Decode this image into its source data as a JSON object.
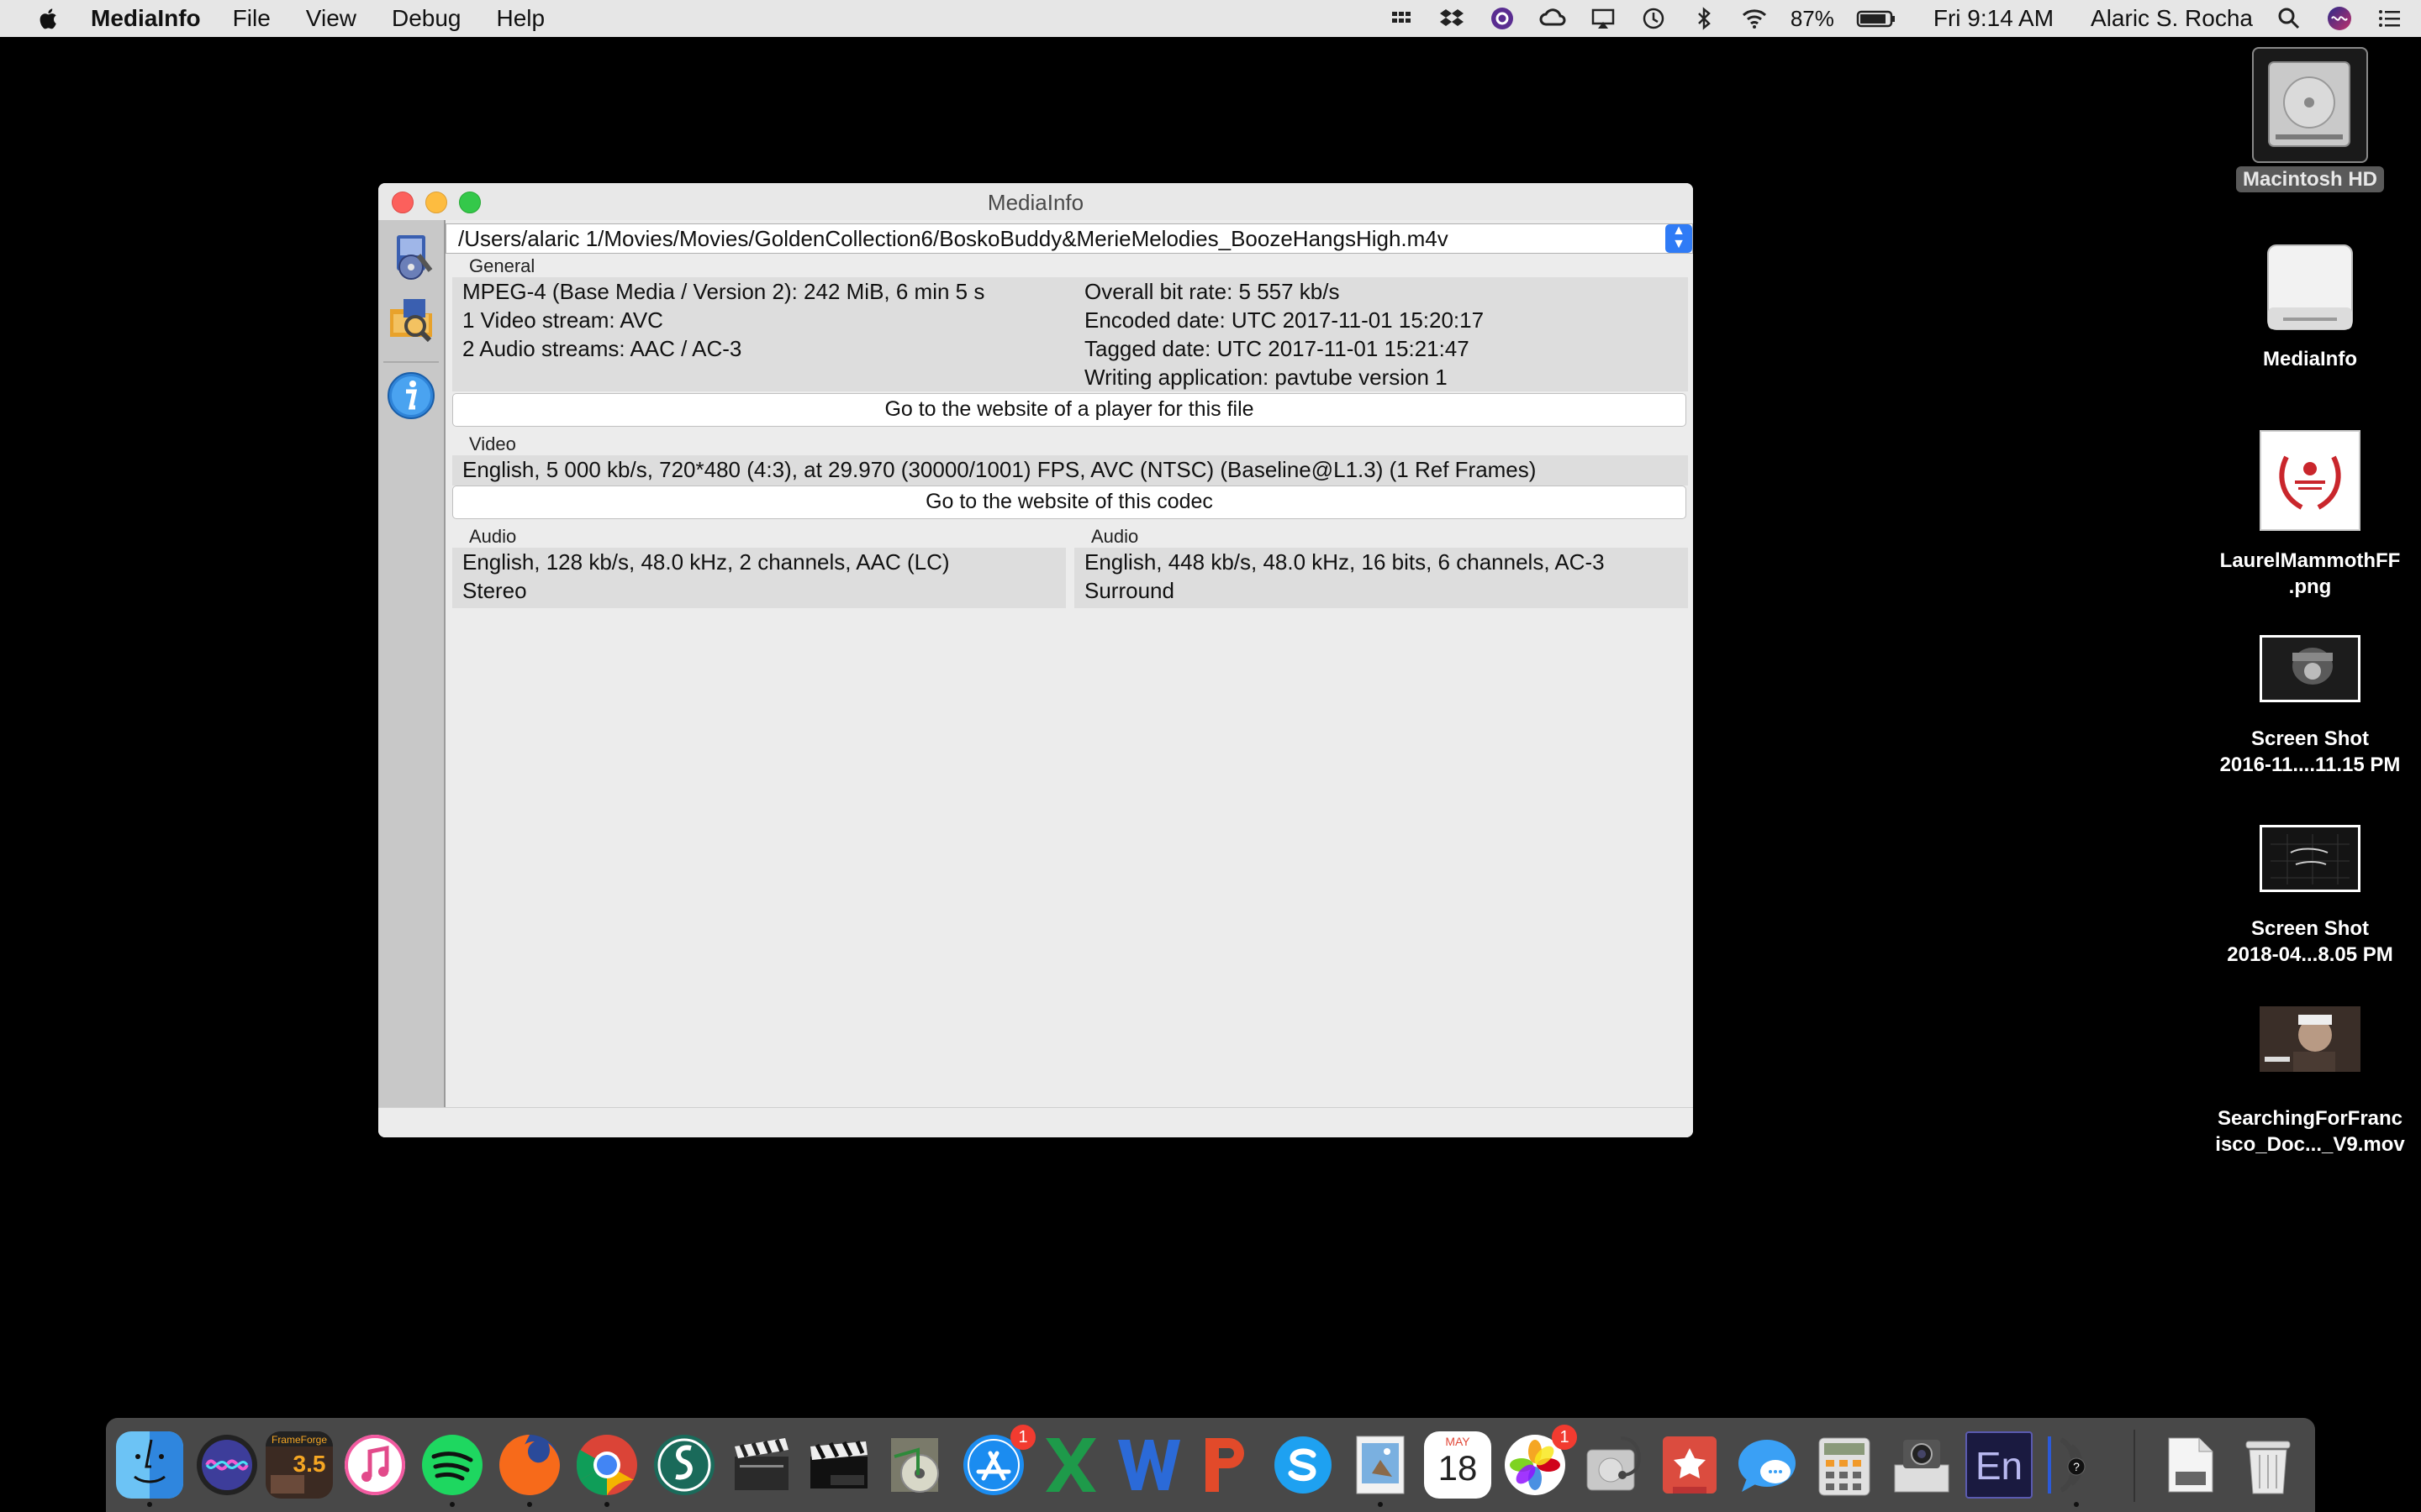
{
  "menubar": {
    "app_name": "MediaInfo",
    "menus": [
      "File",
      "View",
      "Debug",
      "Help"
    ],
    "battery": "87%",
    "clock": "Fri 9:14 AM",
    "user": "Alaric S. Rocha"
  },
  "window": {
    "title": "MediaInfo",
    "file_path": "/Users/alaric 1/Movies/Movies/GoldenCollection6/BoskoBuddy&MerieMelodies_BoozeHangsHigh.m4v",
    "general": {
      "label": "General",
      "left_lines": [
        "MPEG-4 (Base Media / Version 2): 242 MiB, 6 min 5 s",
        "1 Video stream: AVC",
        "2 Audio streams: AAC / AC-3"
      ],
      "right_lines": [
        "Overall bit rate: 5 557 kb/s",
        "Encoded date: UTC 2017-11-01 15:20:17",
        "Tagged date: UTC 2017-11-01 15:21:47",
        "Writing application: pavtube version 1"
      ],
      "button": "Go to the website of a player for this file"
    },
    "video": {
      "label": "Video",
      "line": "English, 5 000 kb/s, 720*480 (4:3), at 29.970 (30000/1001) FPS, AVC (NTSC) (Baseline@L1.3) (1 Ref Frames)",
      "button": "Go to the website of this codec"
    },
    "audio": [
      {
        "label": "Audio",
        "lines": [
          "English, 128 kb/s, 48.0 kHz, 2 channels, AAC (LC)",
          "Stereo"
        ]
      },
      {
        "label": "Audio",
        "lines": [
          "English, 448 kb/s, 48.0 kHz, 16 bits, 6 channels, AC-3",
          "Surround"
        ]
      }
    ]
  },
  "desktop": [
    {
      "name": "Macintosh HD"
    },
    {
      "name": "MediaInfo"
    },
    {
      "name": "LaurelMammothFF\n.png"
    },
    {
      "name": "Screen Shot\n2016-11....11.15 PM"
    },
    {
      "name": "Screen Shot\n2018-04...8.05 PM"
    },
    {
      "name": "SearchingForFranc\nisco_Doc..._V9.mov"
    }
  ],
  "dock": {
    "badges": {
      "app_store": "1",
      "photos": "1"
    },
    "calendar": {
      "month": "MAY",
      "day": "18"
    },
    "en_label": "En",
    "icons": [
      "finder-icon",
      "siri-icon",
      "frameforge-icon",
      "itunes-icon",
      "spotify-icon",
      "firefox-icon",
      "chrome-icon",
      "scrivener-icon",
      "clapper-icon",
      "final-cut-pro-icon",
      "dvd-icon",
      "app-store-icon",
      "excel-icon",
      "word-icon",
      "powerpoint-icon",
      "skype-icon",
      "preview-icon",
      "calendar-icon",
      "photos-icon",
      "disk-utility-icon",
      "wunderlist-icon",
      "messages-icon",
      "calculator-icon",
      "image-capture-icon",
      "encore-icon",
      "audio-icon",
      "file-icon",
      "trash-icon"
    ],
    "frameforge_label": "FrameForge 3.5"
  }
}
